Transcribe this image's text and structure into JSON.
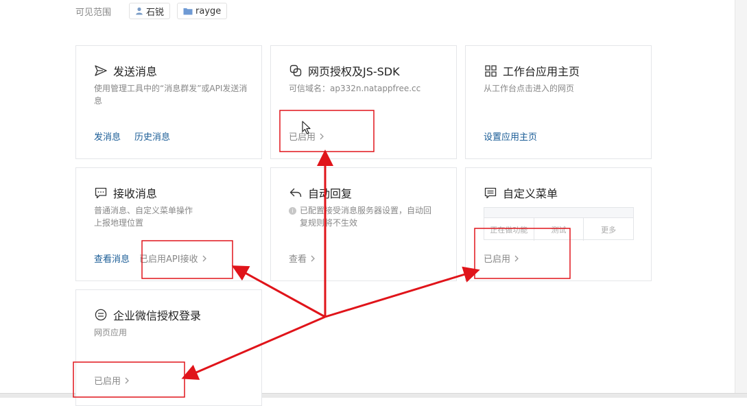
{
  "visibility": {
    "label": "可见范围",
    "chips": [
      {
        "icon": "user-icon",
        "label": "石锐"
      },
      {
        "icon": "folder-icon",
        "label": "rayge"
      }
    ]
  },
  "cards": {
    "send": {
      "title": "发送消息",
      "desc_line1": "使用管理工具中的“消息群发”或API发送消",
      "desc_line2": "息",
      "link1": "发消息",
      "link2": "历史消息"
    },
    "oauth": {
      "title": "网页授权及JS-SDK",
      "desc": "可信域名：ap332n.natappfree.cc",
      "status": "已启用"
    },
    "workbench": {
      "title": "工作台应用主页",
      "desc": "从工作台点击进入的网页",
      "link": "设置应用主页"
    },
    "receive": {
      "title": "接收消息",
      "desc_line1": "普通消息、自定义菜单操作",
      "desc_line2": "上报地理位置",
      "link": "查看消息",
      "status": "已启用API接收"
    },
    "auto_reply": {
      "title": "自动回复",
      "desc_line1": "已配置接受消息服务器设置，自动回",
      "desc_line2": "复规则将不生效",
      "link": "查看"
    },
    "custom_menu": {
      "title": "自定义菜单",
      "menu_items": [
        "正在做功能",
        "测试",
        "更多"
      ],
      "status": "已启用"
    },
    "wework_login": {
      "title": "企业微信授权登录",
      "desc": "网页应用",
      "status": "已启用"
    }
  },
  "colors": {
    "annotation": "#e0141a",
    "link": "#1a5c96",
    "muted": "#888888"
  }
}
